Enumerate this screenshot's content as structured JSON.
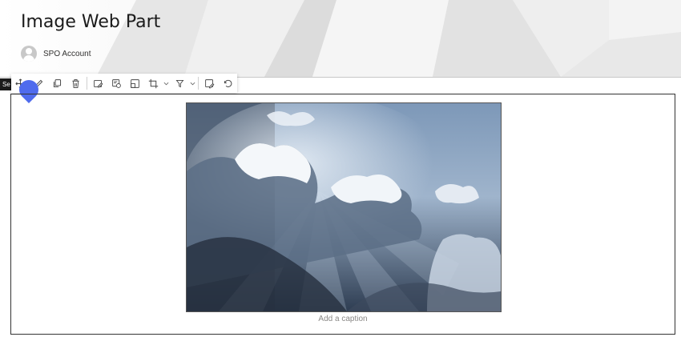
{
  "page": {
    "title": "Image Web Part",
    "author": "SPO Account"
  },
  "select_tag": "Se",
  "image_web_part": {
    "caption_placeholder": "Add a caption"
  },
  "toolbar": {
    "icons": [
      "move-icon",
      "edit-icon",
      "duplicate-icon",
      "delete-icon",
      "edit-image-icon",
      "alt-text-icon",
      "resize-icon",
      "crop-icon",
      "filter-icon",
      "save-icon",
      "reset-icon"
    ]
  },
  "colors": {
    "cursor": "#4f6bed",
    "border": "#333333"
  }
}
